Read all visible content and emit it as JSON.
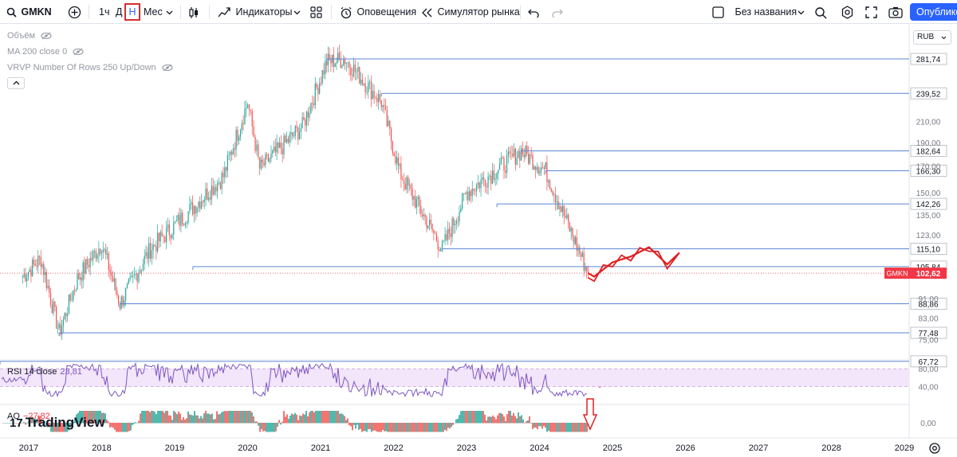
{
  "toolbar": {
    "symbol": "GMKN",
    "timeframes": [
      "1ч",
      "Д",
      "Н",
      "Мес"
    ],
    "active_timeframe": "Н",
    "indicators_label": "Индикаторы",
    "alerts_label": "Оповещения",
    "replay_label": "Симулятор рынка",
    "layout_name": "Без названия",
    "publish_label": "Опубликов"
  },
  "legend": {
    "volume": "Объём",
    "ma": "MA 200 close 0",
    "vrvp": "VRVP Number Of Rows 250 Up/Down"
  },
  "currency": "RUB",
  "price_axis": {
    "ticks": [
      "210,00",
      "190,00",
      "170,00",
      "150,00",
      "135,00",
      "123,00",
      "91,00",
      "83,00",
      "75,00"
    ],
    "levels": [
      "281,74",
      "239,52",
      "182,64",
      "166,30",
      "142,26",
      "115,10",
      "105,84",
      "88,86",
      "77,48",
      "67,72"
    ],
    "last_price": "102,62",
    "last_symbol": "GMKN"
  },
  "rsi": {
    "label": "RSI 14 close",
    "value": "23,81",
    "ticks": [
      "80,00",
      "40,00"
    ]
  },
  "ao": {
    "label": "AO",
    "value": "−27,82",
    "ticks": [
      "0,00"
    ]
  },
  "time_axis": [
    "2017",
    "2018",
    "2019",
    "2020",
    "2021",
    "2022",
    "2023",
    "2024",
    "2025",
    "2026",
    "2027",
    "2028",
    "2029"
  ],
  "brand": "TradingView",
  "colors": {
    "up": "#26a69a",
    "down": "#ef5350",
    "level_line": "#5b86d4",
    "last_price": "#f23645",
    "rsi_line": "#7e57c2",
    "rsi_band": "#f3e5fa",
    "annotation": "#e02020",
    "accent": "#2962ff"
  },
  "chart_data": {
    "type": "candlestick",
    "symbol": "GMKN",
    "timeframe": "weekly",
    "currency": "RUB",
    "price_path_key_points": [
      {
        "date": "2016-12",
        "close": 101
      },
      {
        "date": "2017-03",
        "close": 110
      },
      {
        "date": "2017-06",
        "close": 77.5
      },
      {
        "date": "2017-09",
        "close": 100
      },
      {
        "date": "2018-01",
        "close": 118
      },
      {
        "date": "2018-04",
        "close": 88.9
      },
      {
        "date": "2018-09",
        "close": 115
      },
      {
        "date": "2019-03",
        "close": 136
      },
      {
        "date": "2019-09",
        "close": 162
      },
      {
        "date": "2020-01",
        "close": 230
      },
      {
        "date": "2020-03",
        "close": 168
      },
      {
        "date": "2020-10",
        "close": 205
      },
      {
        "date": "2021-02",
        "close": 278
      },
      {
        "date": "2021-05",
        "close": 281.74
      },
      {
        "date": "2021-11",
        "close": 230
      },
      {
        "date": "2022-02",
        "close": 165
      },
      {
        "date": "2022-09",
        "close": 115.1
      },
      {
        "date": "2023-01",
        "close": 150
      },
      {
        "date": "2023-10",
        "close": 182.64
      },
      {
        "date": "2024-02",
        "close": 166.3
      },
      {
        "date": "2024-09",
        "close": 102.62
      }
    ],
    "horizontal_levels": [
      281.74,
      239.52,
      182.64,
      166.3,
      142.26,
      115.1,
      105.84,
      88.86,
      77.48,
      67.72
    ],
    "last_price": 102.62,
    "projection_zigzag": [
      {
        "date": "2024-09",
        "close": 102.62
      },
      {
        "date": "2024-10",
        "close": 101
      },
      {
        "date": "2025-01",
        "close": 108
      },
      {
        "date": "2025-04",
        "close": 111
      },
      {
        "date": "2025-07",
        "close": 116
      },
      {
        "date": "2025-10",
        "close": 107
      },
      {
        "date": "2025-12",
        "close": 113
      }
    ],
    "rsi": {
      "name": "RSI 14 close",
      "last": 23.81,
      "band": [
        40,
        80
      ]
    },
    "ao": {
      "name": "AO",
      "last": -27.82
    }
  }
}
